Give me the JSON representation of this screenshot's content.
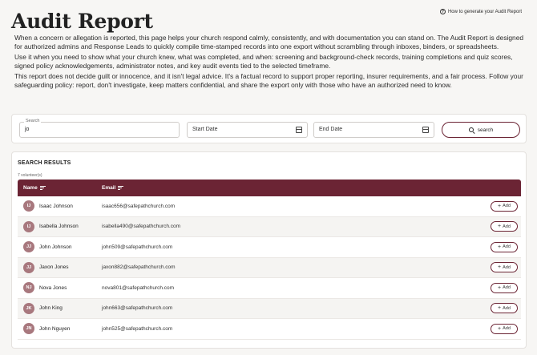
{
  "page": {
    "title": "Audit Report",
    "help_link": "How to generate your Audit Report",
    "intro": [
      "When a concern or allegation is reported, this page helps your church respond calmly, consistently, and with documentation you can stand on. The Audit Report is designed for authorized admins and Response Leads to quickly compile time-stamped records into one export without scrambling through inboxes, binders, or spreadsheets.",
      "Use it when you need to show what your church knew, what was completed, and when: screening and background-check records, training completions and quiz scores, signed policy acknowledgements, administrator notes, and key audit events tied to the selected timeframe.",
      "This report does not decide guilt or innocence, and it isn't legal advice. It's a factual record to support proper reporting, insurer requirements, and a fair process. Follow your safeguarding policy: report, don't investigate, keep matters confidential, and share the export only with those who have an authorized need to know."
    ]
  },
  "search": {
    "legend": "Search",
    "value": "jo",
    "start_date_placeholder": "Start Date",
    "end_date_placeholder": "End Date",
    "button_label": "search"
  },
  "results": {
    "title": "SEARCH RESULTS",
    "count": "7 volunteer(s)",
    "columns": {
      "name": "Name",
      "email": "Email"
    },
    "add_label": "Add",
    "rows": [
      {
        "initials": "IJ",
        "name": "Isaac Johnson",
        "email": "isaac656@safepathchurch.com"
      },
      {
        "initials": "IJ",
        "name": "Isabella Johnson",
        "email": "isabella490@safepathchurch.com"
      },
      {
        "initials": "JJ",
        "name": "John Johnson",
        "email": "john509@safepathchurch.com"
      },
      {
        "initials": "JJ",
        "name": "Jaxon Jones",
        "email": "jaxon882@safepathchurch.com"
      },
      {
        "initials": "NJ",
        "name": "Nova Jones",
        "email": "nova801@safepathchurch.com"
      },
      {
        "initials": "JK",
        "name": "John King",
        "email": "john663@safepathchurch.com"
      },
      {
        "initials": "JN",
        "name": "John Nguyen",
        "email": "john525@safepathchurch.com"
      }
    ]
  },
  "colors": {
    "accent": "#6b2434",
    "avatar": "#a8787e",
    "background": "#f7f6f4"
  }
}
